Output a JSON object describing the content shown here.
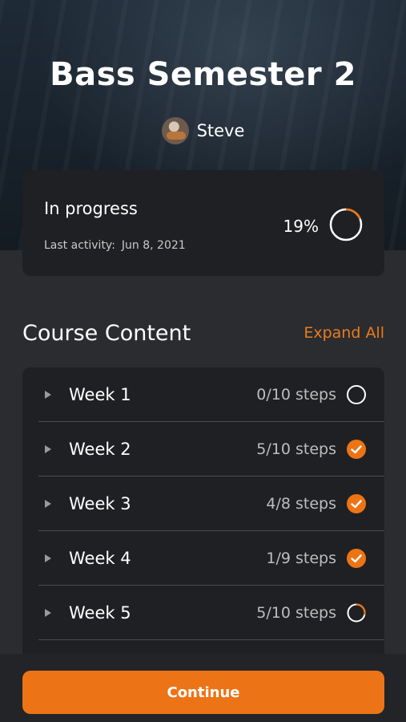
{
  "course": {
    "title": "Bass Semester 2",
    "author": "Steve"
  },
  "progress": {
    "status": "In progress",
    "last_activity_label": "Last activity:",
    "last_activity_date": "Jun 8, 2021",
    "percent_text": "19%",
    "percent_value": 0.19
  },
  "content": {
    "title": "Course Content",
    "expand_all": "Expand All",
    "weeks": [
      {
        "label": "Week 1",
        "steps": "0/10 steps",
        "status": "not-started"
      },
      {
        "label": "Week 2",
        "steps": "5/10 steps",
        "status": "checked"
      },
      {
        "label": "Week 3",
        "steps": "4/8 steps",
        "status": "checked"
      },
      {
        "label": "Week 4",
        "steps": "1/9 steps",
        "status": "checked"
      },
      {
        "label": "Week 5",
        "steps": "5/10 steps",
        "status": "partial"
      }
    ]
  },
  "actions": {
    "continue_label": "Continue"
  },
  "colors": {
    "accent": "#ec7416",
    "card": "#1f2023",
    "background": "#2a2c30"
  }
}
